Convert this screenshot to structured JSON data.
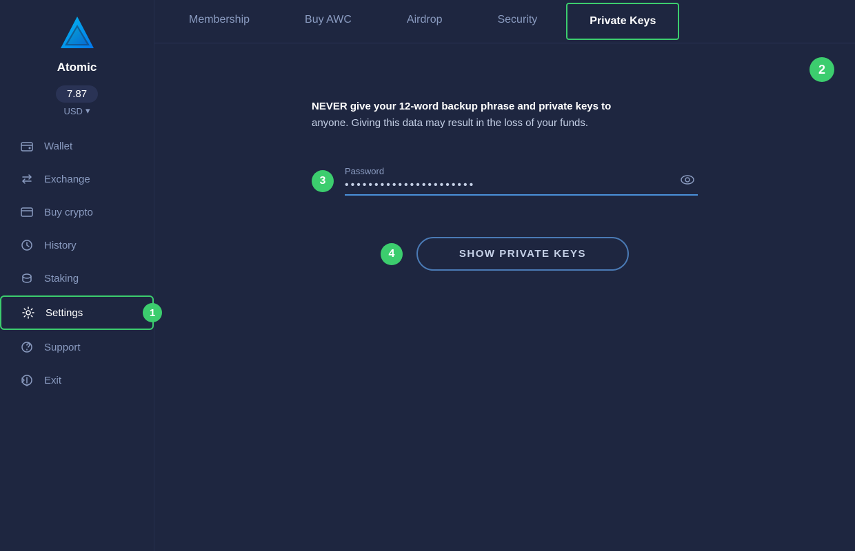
{
  "sidebar": {
    "logo_name": "Atomic",
    "balance": "7.87",
    "currency": "USD",
    "nav_items": [
      {
        "id": "wallet",
        "label": "Wallet",
        "icon": "wallet-icon"
      },
      {
        "id": "exchange",
        "label": "Exchange",
        "icon": "exchange-icon"
      },
      {
        "id": "buy-crypto",
        "label": "Buy crypto",
        "icon": "buy-crypto-icon"
      },
      {
        "id": "history",
        "label": "History",
        "icon": "history-icon"
      },
      {
        "id": "staking",
        "label": "Staking",
        "icon": "staking-icon"
      },
      {
        "id": "settings",
        "label": "Settings",
        "icon": "settings-icon",
        "active": true
      },
      {
        "id": "support",
        "label": "Support",
        "icon": "support-icon"
      },
      {
        "id": "exit",
        "label": "Exit",
        "icon": "exit-icon"
      }
    ],
    "step1_label": "1"
  },
  "tabs": [
    {
      "id": "membership",
      "label": "Membership"
    },
    {
      "id": "buy-awc",
      "label": "Buy AWC"
    },
    {
      "id": "airdrop",
      "label": "Airdrop"
    },
    {
      "id": "security",
      "label": "Security"
    },
    {
      "id": "private-keys",
      "label": "Private Keys",
      "active": true
    }
  ],
  "content": {
    "step2_label": "2",
    "warning_text_bold": "NEVER give your 12-word backup phrase and private keys to",
    "warning_text_normal": "anyone. Giving this data may result in the loss of your funds.",
    "password_label": "Password",
    "password_value": "••••••••••••••••••••••",
    "step3_label": "3",
    "step4_label": "4",
    "show_keys_button": "SHOW PRIVATE KEYS"
  }
}
